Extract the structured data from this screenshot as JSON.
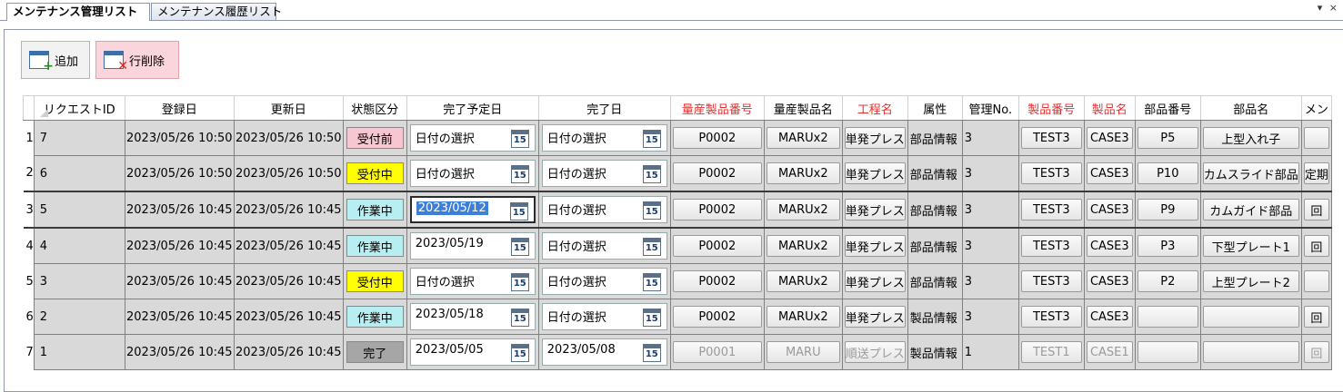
{
  "tabs": [
    {
      "label": "メンテナンス管理リスト",
      "active": true
    },
    {
      "label": "メンテナンス履歴リスト",
      "active": false
    }
  ],
  "window_controls": "▾ ×",
  "toolbar": {
    "add_label": "追加",
    "delete_label": "行削除"
  },
  "grid": {
    "columns": [
      {
        "label": "",
        "required": false
      },
      {
        "label": "リクエストID",
        "required": false
      },
      {
        "label": "登録日",
        "required": false
      },
      {
        "label": "更新日",
        "required": false
      },
      {
        "label": "状態区分",
        "required": false
      },
      {
        "label": "完了予定日",
        "required": false
      },
      {
        "label": "完了日",
        "required": false
      },
      {
        "label": "量産製品番号",
        "required": true
      },
      {
        "label": "量産製品名",
        "required": false
      },
      {
        "label": "工程名",
        "required": true
      },
      {
        "label": "属性",
        "required": false
      },
      {
        "label": "管理No.",
        "required": false
      },
      {
        "label": "製品番号",
        "required": true
      },
      {
        "label": "製品名",
        "required": true
      },
      {
        "label": "部品番号",
        "required": false
      },
      {
        "label": "部品名",
        "required": false
      },
      {
        "label": "メン",
        "required": false
      }
    ],
    "rows": [
      {
        "num": "1",
        "id": "7",
        "reg": "2023/05/26 10:50",
        "upd": "2023/05/26 10:50",
        "state": "受付前",
        "state_color": "#f7c6d0",
        "planned": "日付の選択",
        "done": "日付の選択",
        "mp_no": "P0002",
        "mp_name": "MARUx2",
        "process": "単発プレス",
        "attr": "部品情報",
        "mgmt": "3",
        "prod_no": "TEST3",
        "prod_name": "CASE3",
        "part_no": "P5",
        "part_name": "上型入れ子",
        "maint": "",
        "disabled": false
      },
      {
        "num": "2",
        "id": "6",
        "reg": "2023/05/26 10:50",
        "upd": "2023/05/26 10:50",
        "state": "受付中",
        "state_color": "#ffff00",
        "planned": "日付の選択",
        "done": "日付の選択",
        "mp_no": "P0002",
        "mp_name": "MARUx2",
        "process": "単発プレス",
        "attr": "部品情報",
        "mgmt": "3",
        "prod_no": "TEST3",
        "prod_name": "CASE3",
        "part_no": "P10",
        "part_name": "カムスライド部品",
        "maint": "定期",
        "disabled": false
      },
      {
        "num": "3",
        "id": "5",
        "reg": "2023/05/26 10:45",
        "upd": "2023/05/26 10:45",
        "state": "作業中",
        "state_color": "#b6eef2",
        "planned": "2023/05/12",
        "done": "日付の選択",
        "mp_no": "P0002",
        "mp_name": "MARUx2",
        "process": "単発プレス",
        "attr": "部品情報",
        "mgmt": "3",
        "prod_no": "TEST3",
        "prod_name": "CASE3",
        "part_no": "P9",
        "part_name": "カムガイド部品",
        "maint": "回",
        "disabled": false
      },
      {
        "num": "4",
        "id": "4",
        "reg": "2023/05/26 10:45",
        "upd": "2023/05/26 10:45",
        "state": "作業中",
        "state_color": "#b6eef2",
        "planned": "2023/05/19",
        "done": "日付の選択",
        "mp_no": "P0002",
        "mp_name": "MARUx2",
        "process": "単発プレス",
        "attr": "部品情報",
        "mgmt": "3",
        "prod_no": "TEST3",
        "prod_name": "CASE3",
        "part_no": "P3",
        "part_name": "下型プレート1",
        "maint": "回",
        "disabled": false
      },
      {
        "num": "5",
        "id": "3",
        "reg": "2023/05/26 10:45",
        "upd": "2023/05/26 10:45",
        "state": "受付中",
        "state_color": "#ffff00",
        "planned": "日付の選択",
        "done": "日付の選択",
        "mp_no": "P0002",
        "mp_name": "MARUx2",
        "process": "単発プレス",
        "attr": "部品情報",
        "mgmt": "3",
        "prod_no": "TEST3",
        "prod_name": "CASE3",
        "part_no": "P2",
        "part_name": "上型プレート2",
        "maint": "",
        "disabled": false
      },
      {
        "num": "6",
        "id": "2",
        "reg": "2023/05/26 10:45",
        "upd": "2023/05/26 10:45",
        "state": "作業中",
        "state_color": "#b6eef2",
        "planned": "2023/05/18",
        "done": "日付の選択",
        "mp_no": "P0002",
        "mp_name": "MARUx2",
        "process": "単発プレス",
        "attr": "製品情報",
        "mgmt": "3",
        "prod_no": "TEST3",
        "prod_name": "CASE3",
        "part_no": "",
        "part_name": "",
        "maint": "回",
        "disabled": false
      },
      {
        "num": "7",
        "id": "1",
        "reg": "2023/05/26 10:45",
        "upd": "2023/05/26 10:45",
        "state": "完了",
        "state_color": "#a6a6a6",
        "planned": "2023/05/05",
        "done": "2023/05/08",
        "mp_no": "P0001",
        "mp_name": "MARU",
        "process": "順送プレス",
        "attr": "製品情報",
        "mgmt": "1",
        "prod_no": "TEST1",
        "prod_name": "CASE1",
        "part_no": "",
        "part_name": "",
        "maint": "回",
        "disabled": true
      }
    ],
    "calendar_icon_text": "15",
    "selected_row": 2
  }
}
